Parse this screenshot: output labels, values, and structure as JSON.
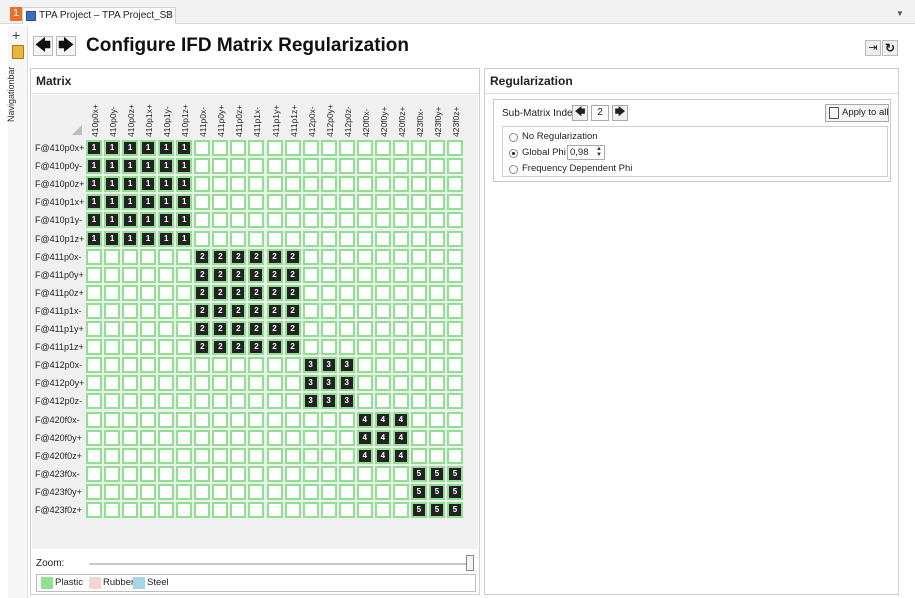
{
  "tab": {
    "number": "1",
    "title": "TPA Project – TPA Project_SB",
    "close": "×"
  },
  "navigation": {
    "plus": "+",
    "label": "Navigationbar"
  },
  "header": {
    "back": "🡄",
    "forward": "🡆",
    "title": "Configure IFD Matrix Regularization"
  },
  "matrix": {
    "title": "Matrix",
    "columns": [
      "410p0x+",
      "410p0y-",
      "410p0z+",
      "410p1x+",
      "410p1y-",
      "410p1z+",
      "411p0x-",
      "411p0y+",
      "411p0z+",
      "411p1x-",
      "411p1y+",
      "411p1z+",
      "412p0x-",
      "412p0y+",
      "412p0z-",
      "420f0x-",
      "420f0y+",
      "420f0z+",
      "423f0x-",
      "423f0y+",
      "423f0z+"
    ],
    "rows": [
      "F@410p0x+",
      "F@410p0y-",
      "F@410p0z+",
      "F@410p1x+",
      "F@410p1y-",
      "F@410p1z+",
      "F@411p0x-",
      "F@411p0y+",
      "F@411p0z+",
      "F@411p1x-",
      "F@411p1y+",
      "F@411p1z+",
      "F@412p0x-",
      "F@412p0y+",
      "F@412p0z-",
      "F@420f0x-",
      "F@420f0y+",
      "F@420f0z+",
      "F@423f0x-",
      "F@423f0y+",
      "F@423f0z+"
    ],
    "blocks": [
      {
        "index": "1",
        "start": 0,
        "size": 6
      },
      {
        "index": "2",
        "start": 6,
        "size": 6
      },
      {
        "index": "3",
        "start": 12,
        "size": 3
      },
      {
        "index": "4",
        "start": 15,
        "size": 3
      },
      {
        "index": "5",
        "start": 18,
        "size": 3
      }
    ],
    "zoom_label": "Zoom:",
    "zoom_value": 1.0
  },
  "legend": [
    {
      "label": "Plastic",
      "color": "#8fe08f"
    },
    {
      "label": "Rubber",
      "color": "#f5d5d0"
    },
    {
      "label": "Steel",
      "color": "#a8d4ec"
    }
  ],
  "regularization": {
    "title": "Regularization",
    "submatrix_label": "Sub-Matrix Index",
    "submatrix_value": "2",
    "apply_label": "Apply to all",
    "options": [
      {
        "label": "No Regularization",
        "checked": false
      },
      {
        "label": "Global Phi",
        "checked": true
      },
      {
        "label": "Frequency Dependent Phi",
        "checked": false
      }
    ],
    "global_phi_value": "0,98"
  }
}
